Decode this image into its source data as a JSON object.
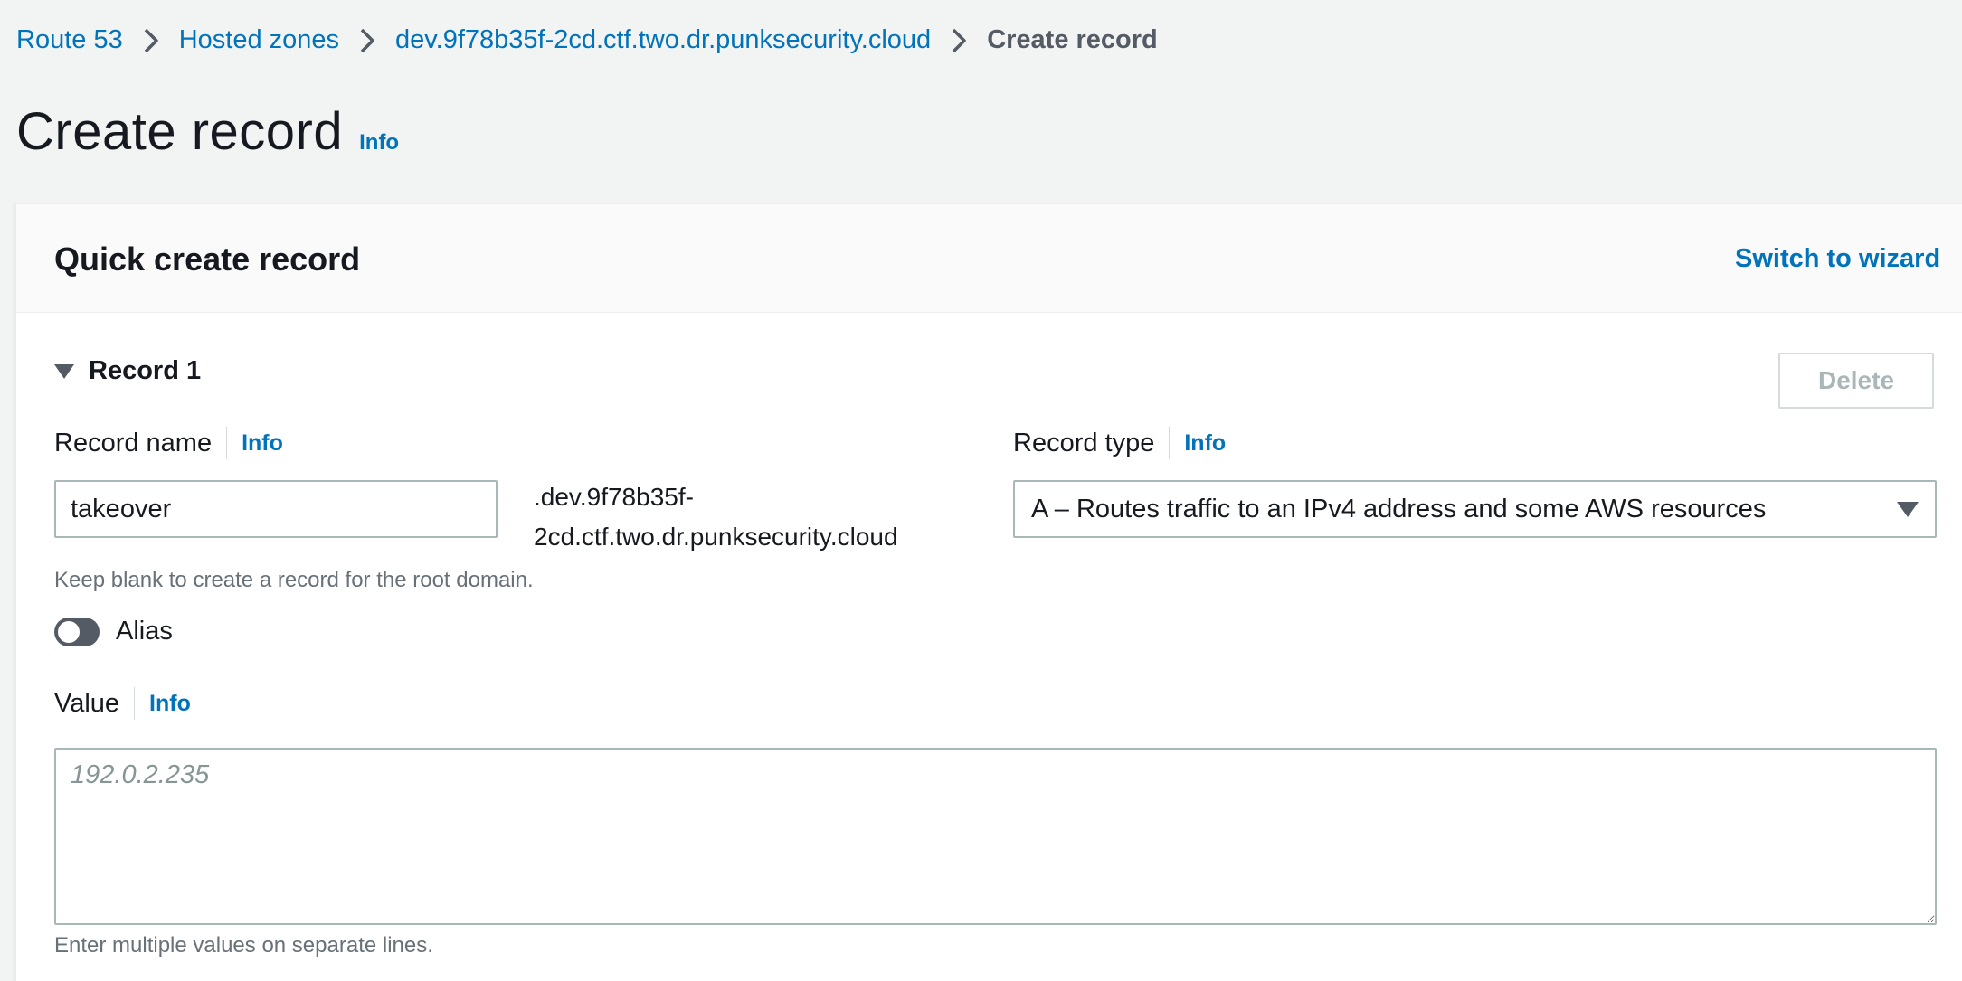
{
  "breadcrumb": {
    "items": [
      "Route 53",
      "Hosted zones",
      "dev.9f78b35f-2cd.ctf.two.dr.punksecurity.cloud"
    ],
    "current": "Create record"
  },
  "page": {
    "title": "Create record",
    "info": "Info"
  },
  "panel": {
    "title": "Quick create record",
    "switch_label": "Switch to wizard"
  },
  "record": {
    "title": "Record 1",
    "delete_label": "Delete",
    "name_label": "Record name",
    "name_info": "Info",
    "name_value": "takeover",
    "domain_suffix_line1": ".dev.9f78b35f-",
    "domain_suffix_line2": "2cd.ctf.two.dr.punksecurity.cloud",
    "name_hint": "Keep blank to create a record for the root domain.",
    "type_label": "Record type",
    "type_info": "Info",
    "type_value": "A – Routes traffic to an IPv4 address and some AWS resources",
    "alias_label": "Alias",
    "alias_enabled": false,
    "value_label": "Value",
    "value_info": "Info",
    "value_placeholder": "192.0.2.235",
    "value_hint": "Enter multiple values on separate lines."
  },
  "colors": {
    "link": "#0073bb",
    "text": "#16191f",
    "muted": "#687078",
    "background": "#f2f3f3"
  },
  "icons": [
    "chevron-right-icon",
    "caret-down-icon",
    "dropdown-arrow-icon",
    "toggle-switch"
  ]
}
